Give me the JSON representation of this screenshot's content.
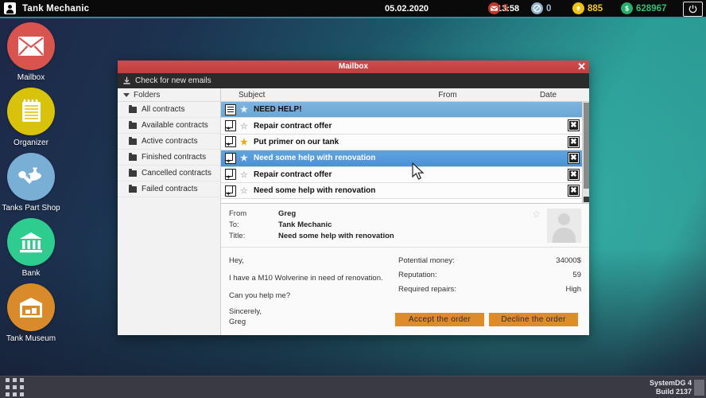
{
  "topbar": {
    "user_icon": "user-icon",
    "app_title": "Tank Mechanic",
    "date": "05.02.2020",
    "time": "13:58",
    "stats": [
      {
        "icon": "mail-blocked-icon",
        "value": "5",
        "color": "#c0392b"
      },
      {
        "icon": "no-entry-icon",
        "value": "0",
        "color": "#8fb4cc"
      },
      {
        "icon": "coin-up-icon",
        "value": "885",
        "color": "#f0c40a"
      },
      {
        "icon": "dollar-coin-icon",
        "value": "628967",
        "color": "#25b06b"
      }
    ],
    "power_icon": "power-icon"
  },
  "desktop": {
    "items": [
      {
        "label": "Mailbox",
        "icon": "envelope-icon",
        "color": "#d9534f"
      },
      {
        "label": "Organizer",
        "icon": "notebook-icon",
        "color": "#d9c20a"
      },
      {
        "label": "Tanks Part Shop",
        "icon": "wrench-icon",
        "color": "#79afd4"
      },
      {
        "label": "Bank",
        "icon": "bank-icon",
        "color": "#2ecc8f"
      },
      {
        "label": "Tank Museum",
        "icon": "museum-icon",
        "color": "#d98b2b"
      }
    ]
  },
  "window": {
    "title": "Mailbox",
    "close_label": "✕",
    "toolbar": {
      "check_label": "Check for new emails",
      "download_icon": "download-icon"
    },
    "folders": {
      "header": "Folders",
      "items": [
        "All contracts",
        "Available contracts",
        "Active contracts",
        "Finished contracts",
        "Cancelled contracts",
        "Failed contracts"
      ]
    },
    "list": {
      "columns": {
        "subject": "Subject",
        "from": "From",
        "date": "Date"
      },
      "rows": [
        {
          "subject": "NEED HELP!",
          "icon": "document-icon",
          "starred": "partial",
          "selected": "first",
          "deletable": false
        },
        {
          "subject": "Repair contract offer",
          "icon": "contract-icon",
          "starred": "off",
          "selected": "no",
          "deletable": true
        },
        {
          "subject": "Put primer on our tank",
          "icon": "contract-icon",
          "starred": "on",
          "selected": "no",
          "deletable": true
        },
        {
          "subject": "Need some help with renovation",
          "icon": "contract-icon",
          "starred": "partial",
          "selected": "yes",
          "deletable": true
        },
        {
          "subject": "Repair contract offer",
          "icon": "contract-icon",
          "starred": "off",
          "selected": "no",
          "deletable": true
        },
        {
          "subject": "Need some help with renovation",
          "icon": "contract-icon",
          "starred": "off",
          "selected": "no",
          "deletable": true
        }
      ],
      "delete_label": "✖"
    },
    "detail": {
      "from_label": "From",
      "from_value": "Greg",
      "to_label": "To:",
      "to_value": "Tank Mechanic",
      "title_label": "Title:",
      "title_value": "Need some help with renovation",
      "star_icon": "star-outline-icon",
      "avatar": "avatar-placeholder",
      "body_lines": [
        "Hey,",
        "I have a M10 Wolverine in need of renovation.",
        "Can you help me?",
        "Sincerely,",
        "Greg"
      ],
      "facts": [
        {
          "key": "Potential money:",
          "value": "34000$"
        },
        {
          "key": "Reputation:",
          "value": "59"
        },
        {
          "key": "Required repairs:",
          "value": "High"
        }
      ],
      "accept_label": "Accept the order",
      "decline_label": "Decline the order"
    }
  },
  "taskbar": {
    "launcher_icon": "app-grid-icon",
    "system_name": "SystemDG 4",
    "build": "Build 2137"
  }
}
